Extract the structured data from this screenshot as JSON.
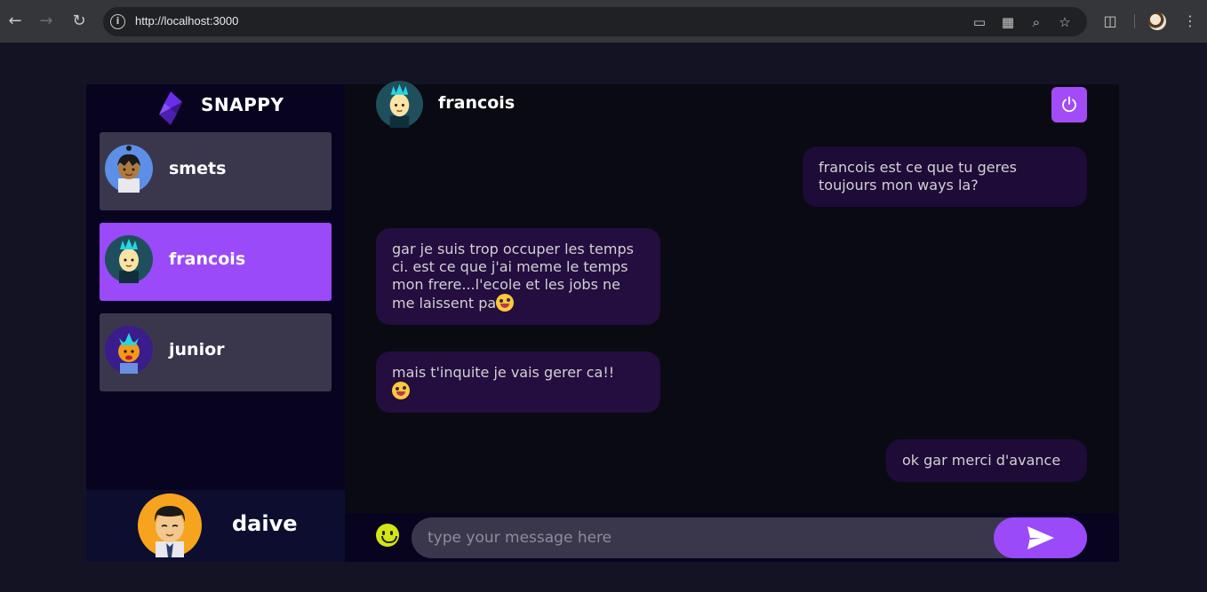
{
  "browser": {
    "url": "http://localhost:3000"
  },
  "brand": {
    "name": "SNAPPY"
  },
  "contacts": [
    {
      "name": "smets",
      "selected": false
    },
    {
      "name": "francois",
      "selected": true
    },
    {
      "name": "junior",
      "selected": false
    }
  ],
  "current_user": {
    "name": "daive"
  },
  "chat": {
    "title": "francois",
    "messages": [
      {
        "direction": "sent",
        "text": "francois est ce que tu geres toujours mon ways la?"
      },
      {
        "direction": "received",
        "text": "gar je suis trop occuper les temps ci. est ce que j'ai meme le temps mon frere...l'ecole et les jobs ne me laissent pa",
        "emoji": "grinning-tongue"
      },
      {
        "direction": "received",
        "text": "mais t'inquite je vais gerer ca!!",
        "emoji": "grinning-tongue"
      },
      {
        "direction": "sent",
        "text": "ok gar merci d'avance"
      }
    ],
    "input_placeholder": "type your message here"
  },
  "colors": {
    "accent": "#9a4af8",
    "background": "#131324",
    "panel": "#080420"
  }
}
